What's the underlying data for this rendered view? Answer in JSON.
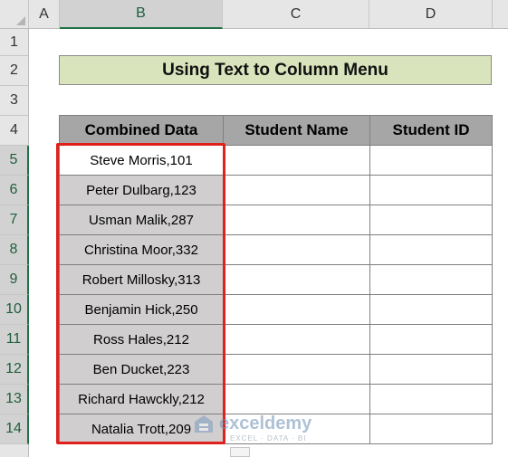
{
  "columns": [
    "A",
    "B",
    "C",
    "D"
  ],
  "rows": [
    "1",
    "2",
    "3",
    "4",
    "5",
    "6",
    "7",
    "8",
    "9",
    "10",
    "11",
    "12",
    "13",
    "14"
  ],
  "title": "Using Text to Column Menu",
  "table": {
    "headers": [
      "Combined Data",
      "Student Name",
      "Student ID"
    ],
    "rows": [
      [
        "Steve Morris,101",
        "",
        ""
      ],
      [
        "Peter Dulbarg,123",
        "",
        ""
      ],
      [
        "Usman Malik,287",
        "",
        ""
      ],
      [
        "Christina Moor,332",
        "",
        ""
      ],
      [
        "Robert Millosky,313",
        "",
        ""
      ],
      [
        "Benjamin Hick,250",
        "",
        ""
      ],
      [
        "Ross Hales,212",
        "",
        ""
      ],
      [
        "Ben Ducket,223",
        "",
        ""
      ],
      [
        "Richard Hawckly,212",
        "",
        ""
      ],
      [
        "Natalia Trott,209",
        "",
        ""
      ]
    ]
  },
  "watermark": {
    "brand": "exceldemy",
    "tagline": "EXCEL · DATA · BI"
  },
  "colors": {
    "title_fill": "#d9e4bc",
    "header_fill": "#a6a6a6",
    "data_fill": "#d0cece",
    "highlight": "#e0201b"
  }
}
